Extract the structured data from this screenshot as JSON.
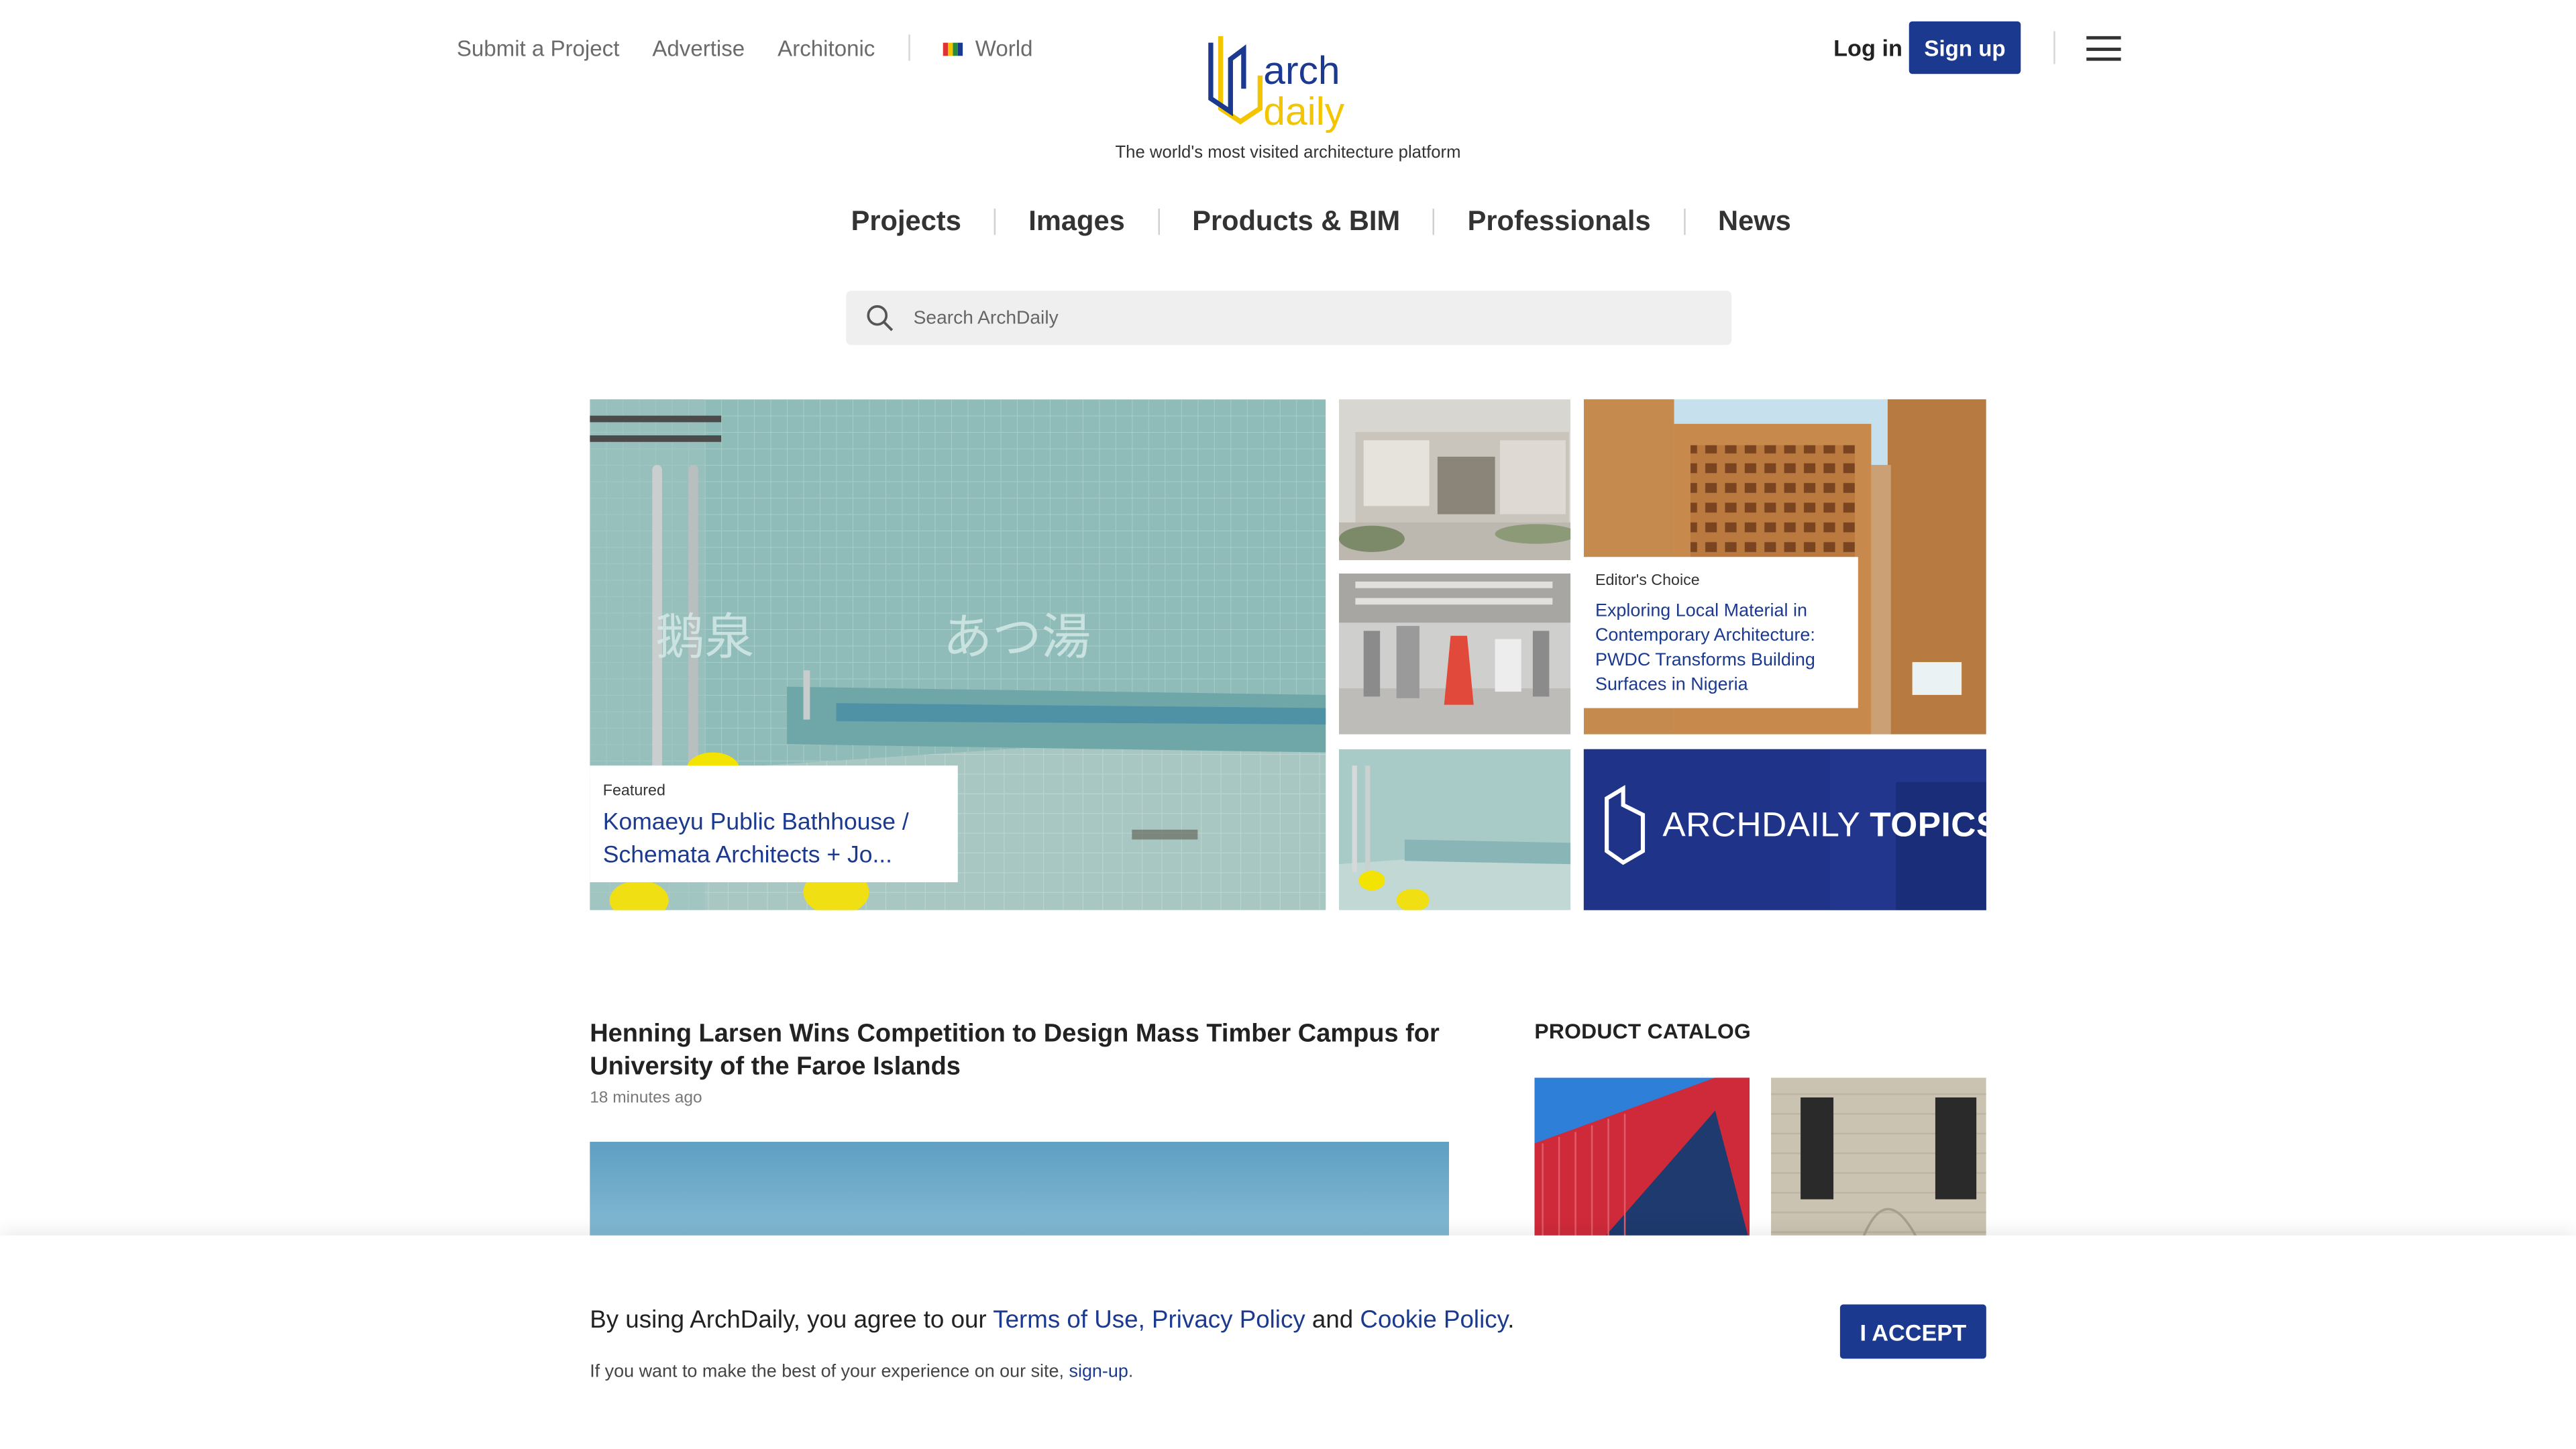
{
  "header": {
    "top_links": [
      "Submit a Project",
      "Advertise",
      "Architonic"
    ],
    "region": "World",
    "logo_text_top": "arch",
    "logo_text_bottom": "daily",
    "tagline": "The world's most visited architecture platform",
    "login_label": "Log in",
    "signup_label": "Sign up"
  },
  "nav": {
    "items": [
      "Projects",
      "Images",
      "Products & BIM",
      "Professionals",
      "News"
    ]
  },
  "search": {
    "placeholder": "Search ArchDaily"
  },
  "hero": {
    "featured_label": "Featured",
    "featured_title": "Komaeyu Public Bathhouse / Schemata Architects + Jo...",
    "editor_label": "Editor's Choice",
    "editor_title": "Exploring Local Material in Contemporary Architecture: PWDC Transforms Building Surfaces in Nigeria",
    "topics_label": "ARCHDAILY",
    "topics_bold": "TOPICS"
  },
  "article": {
    "title": "Henning Larsen Wins Competition to Design Mass Timber Campus for University of the Faroe Islands",
    "time": "18 minutes ago"
  },
  "catalog": {
    "heading": "PRODUCT CATALOG"
  },
  "cookie": {
    "prefix": "By using ArchDaily, you agree to our ",
    "terms": "Terms of Use",
    "comma": ", ",
    "privacy": "Privacy Policy",
    "and": " and ",
    "cookie_policy": "Cookie Policy",
    "period": ".",
    "line2_prefix": "If you want to make the best of your experience on our site, ",
    "signup_link": "sign-up",
    "line2_suffix": ".",
    "accept_label": "I ACCEPT"
  },
  "colors": {
    "brand_blue": "#1b3a8f",
    "logo_yellow": "#f2c500"
  }
}
